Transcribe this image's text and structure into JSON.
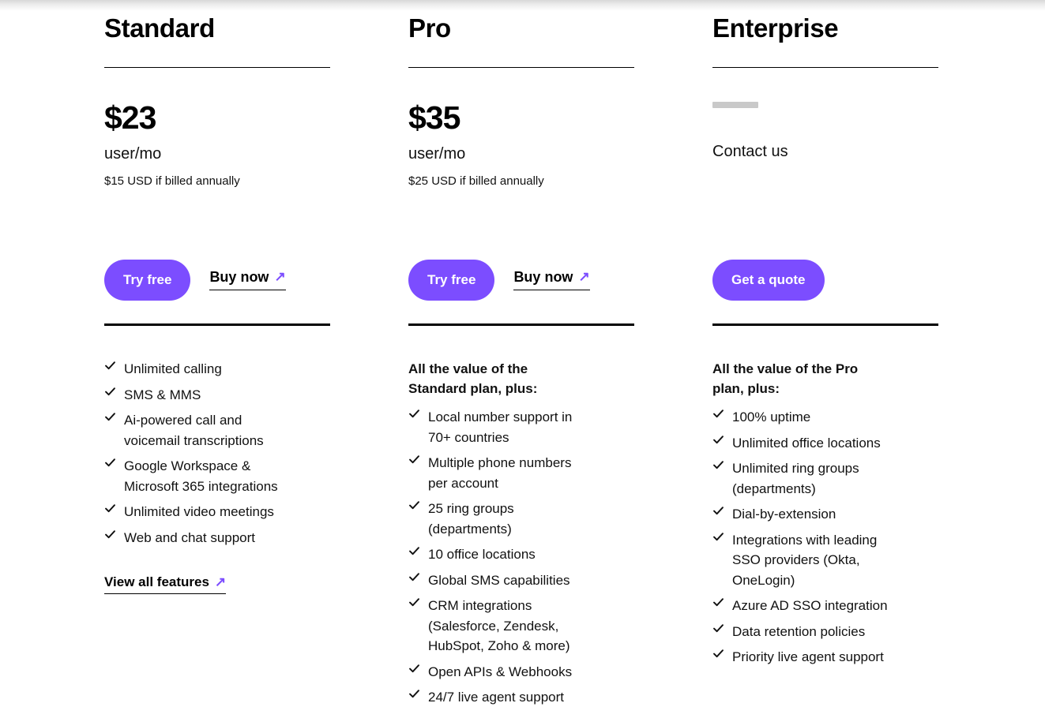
{
  "plans": [
    {
      "name": "Standard",
      "price": "$23",
      "price_unit": "user/mo",
      "price_note": "$15 USD if billed annually",
      "primary_cta": "Try free",
      "secondary_cta": "Buy now",
      "features_intro": "",
      "features": [
        "Unlimited calling",
        "SMS & MMS",
        "Ai-powered call and voicemail transcriptions",
        "Google Workspace & Microsoft 365 integrations",
        "Unlimited video meetings",
        "Web and chat support"
      ],
      "view_all_label": "View all features"
    },
    {
      "name": "Pro",
      "price": "$35",
      "price_unit": "user/mo",
      "price_note": "$25 USD if billed annually",
      "primary_cta": "Try free",
      "secondary_cta": "Buy now",
      "features_intro": "All the value of the Standard plan, plus:",
      "features": [
        "Local number support in 70+ countries",
        "Multiple phone numbers per account",
        "25 ring groups (departments)",
        "10 office locations",
        "Global SMS capabilities",
        "CRM integrations (Salesforce, Zendesk, HubSpot, Zoho & more)",
        "Open APIs & Webhooks",
        "24/7 live agent support"
      ],
      "view_all_label": ""
    },
    {
      "name": "Enterprise",
      "price": "",
      "price_unit": "",
      "price_note": "",
      "contact_text": "Contact us",
      "primary_cta": "Get a quote",
      "secondary_cta": "",
      "features_intro": "All the value of the Pro plan, plus:",
      "features": [
        "100% uptime",
        "Unlimited office locations",
        "Unlimited ring groups (departments)",
        "Dial-by-extension",
        "Integrations with leading SSO providers (Okta, OneLogin)",
        "Azure AD SSO integration",
        "Data retention policies",
        "Priority live agent support"
      ],
      "view_all_label": ""
    }
  ],
  "icons": {
    "arrow_ne": "↗",
    "check": "check-icon"
  },
  "colors": {
    "accent_purple": "#7C4DFF",
    "text_primary": "#111111",
    "rule_black": "#000000",
    "placeholder_gray": "#C9C9C9"
  }
}
